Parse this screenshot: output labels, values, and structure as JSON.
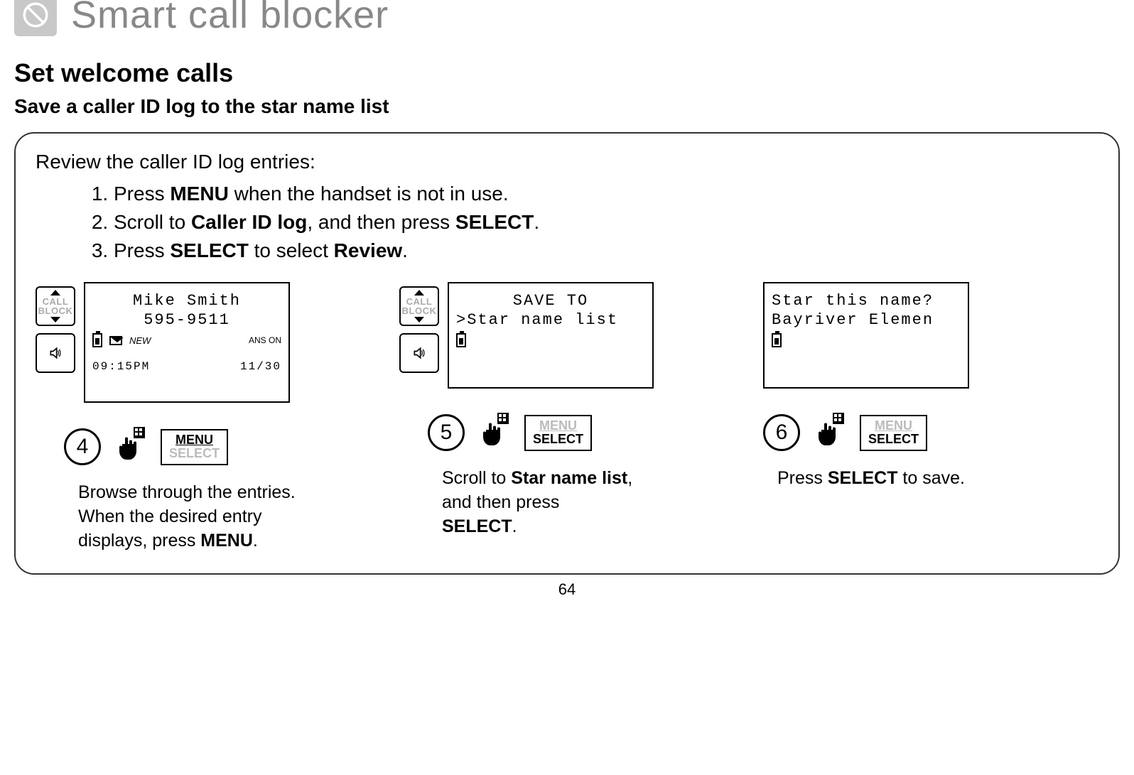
{
  "header": {
    "title": "Smart call blocker"
  },
  "section_title": "Set welcome calls",
  "subsection_title": "Save a caller ID log to the star name list",
  "panel": {
    "intro": "Review the caller ID log entries:",
    "steps": {
      "s1_a": "Press ",
      "s1_b": "MENU",
      "s1_c": " when the handset is not in use.",
      "s2_a": "Scroll to ",
      "s2_b": "Caller ID log",
      "s2_c": ", and then press ",
      "s2_d": "SELECT",
      "s2_e": ".",
      "s3_a": "Press ",
      "s3_b": "SELECT",
      "s3_c": " to select ",
      "s3_d": "Review",
      "s3_e": "."
    }
  },
  "side_button": {
    "call_block_label": "CALL\nBLOCK"
  },
  "screens": {
    "s4": {
      "name": "Mike Smith",
      "number": "595-9511",
      "new_label": "NEW",
      "ans_on": "ANS ON",
      "time": "09:15PM",
      "date": "11/30"
    },
    "s5": {
      "line1": "SAVE TO",
      "line2": ">Star name list"
    },
    "s6": {
      "line1": "Star this name?",
      "line2": "Bayriver Elemen"
    }
  },
  "step_numbers": {
    "n4": "4",
    "n5": "5",
    "n6": "6"
  },
  "menu_select": {
    "menu": "MENU",
    "select": "SELECT"
  },
  "captions": {
    "c4_a": "Browse through the entries. When the desired entry displays, press ",
    "c4_b": "MENU",
    "c4_c": ".",
    "c5_a": "Scroll to ",
    "c5_b": "Star name list",
    "c5_c": ", and then press ",
    "c5_d": "SELECT",
    "c5_e": ".",
    "c6_a": "Press ",
    "c6_b": "SELECT",
    "c6_c": " to save."
  },
  "page_number": "64"
}
